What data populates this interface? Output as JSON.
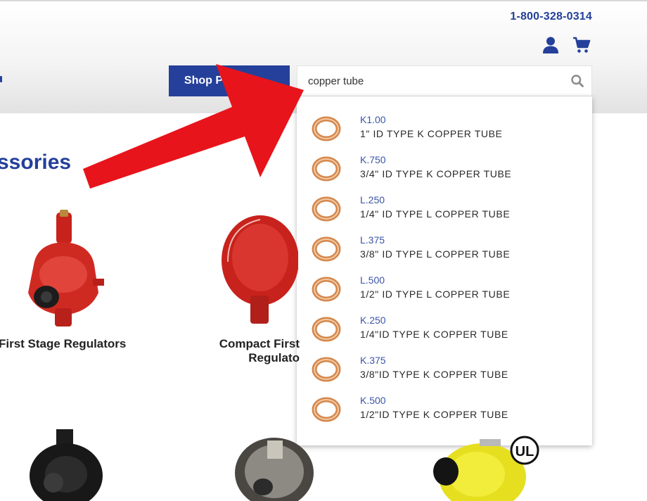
{
  "header": {
    "phone": "1-800-328-0314",
    "shop_button_label": "Shop Products",
    "shop_button_chevron": "⌄",
    "icons": [
      "user-icon",
      "cart-icon",
      "search-icon"
    ]
  },
  "search": {
    "value": "copper tube",
    "suggestions": [
      {
        "code": "K1.00",
        "description": "1\" ID TYPE K COPPER TUBE"
      },
      {
        "code": "K.750",
        "description": "3/4\" ID TYPE K COPPER TUBE"
      },
      {
        "code": "L.250",
        "description": "1/4\" ID TYPE L COPPER TUBE"
      },
      {
        "code": "L.375",
        "description": "3/8\" ID TYPE L COPPER TUBE"
      },
      {
        "code": "L.500",
        "description": "1/2\" ID TYPE L COPPER TUBE"
      },
      {
        "code": "K.250",
        "description": "1/4\"ID TYPE K COPPER TUBE"
      },
      {
        "code": "K.375",
        "description": "3/8\"ID TYPE K COPPER TUBE"
      },
      {
        "code": "K.500",
        "description": "1/2\"ID TYPE K COPPER TUBE"
      }
    ]
  },
  "main": {
    "category_title": "ssories",
    "products": [
      {
        "label": "First Stage Regulators"
      },
      {
        "label_line1": "Compact First",
        "label_line2": "Regulato"
      }
    ]
  },
  "colors": {
    "brand_blue": "#24409a",
    "link_blue": "#3b55a8",
    "arrow_red": "#e8141b",
    "copper": "#d4884e"
  }
}
